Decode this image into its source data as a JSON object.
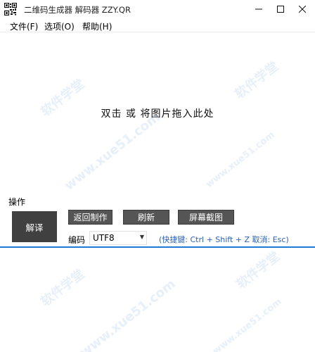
{
  "window": {
    "title": "二维码生成器 解码器 ZZY.QR"
  },
  "menu": {
    "items": [
      {
        "label": "文件(F)"
      },
      {
        "label": "选项(O)"
      },
      {
        "label": "帮助(H)"
      }
    ]
  },
  "drop_area": {
    "hint": "双击 或 将图片拖入此处"
  },
  "operations": {
    "section_label": "操作",
    "decode_label": "解译",
    "return_label": "返回制作",
    "refresh_label": "刷新",
    "capture_label": "屏幕截图",
    "encoding_label": "编码",
    "encoding_value": "UTF8",
    "shortcut_hint": "(快捷键: Ctrl + Shift + Z  取消: Esc)"
  },
  "watermark": {
    "texts": [
      "软件学堂",
      "www.xue51.com"
    ]
  },
  "colors": {
    "accent": "#1e7ad6",
    "button_dark": "#555555",
    "button_decode": "#404040",
    "hint_text": "#2b62b8"
  }
}
